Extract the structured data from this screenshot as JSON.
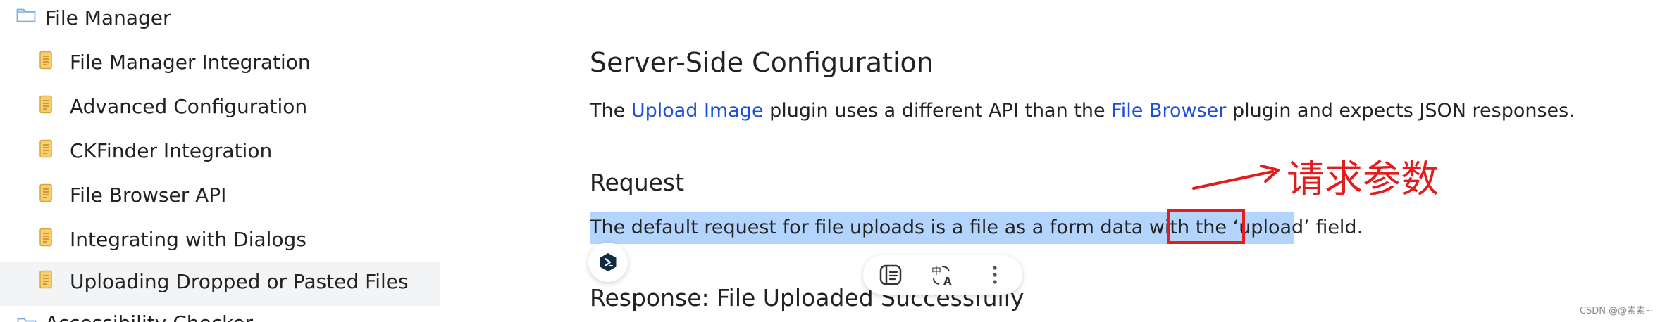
{
  "sidebar": {
    "section_title": "File Manager",
    "items": [
      {
        "label": "File Manager Integration"
      },
      {
        "label": "Advanced Configuration"
      },
      {
        "label": "CKFinder Integration"
      },
      {
        "label": "File Browser API"
      },
      {
        "label": "Integrating with Dialogs"
      },
      {
        "label": "Uploading Dropped or Pasted Files",
        "active": true
      }
    ],
    "next_section_partial": "Accessibility Checker"
  },
  "main": {
    "heading": "Server-Side Configuration",
    "para1": {
      "t1": "The ",
      "link1": "Upload Image",
      "t2": " plugin uses a different API than the ",
      "link2": "File Browser",
      "t3": " plugin and expects JSON responses."
    },
    "request_heading": "Request",
    "para2": {
      "t1": "The default request for file uploads is a file as a form data with the ",
      "code": "‘upload’",
      "t2": " field."
    },
    "next_heading": "Response: File Uploaded Successfully"
  },
  "annotation": {
    "text": "请求参数",
    "color": "#e11d1d"
  },
  "toolbar": {
    "buttons": [
      "panel-icon",
      "translate-icon",
      "more-vertical-icon"
    ]
  },
  "colors": {
    "link": "#1d4ed8",
    "selection": "#b3d4fc",
    "annotation": "#e11d1d",
    "active_item_bg": "#f3f4f5"
  },
  "watermark": "CSDN @@素素~"
}
